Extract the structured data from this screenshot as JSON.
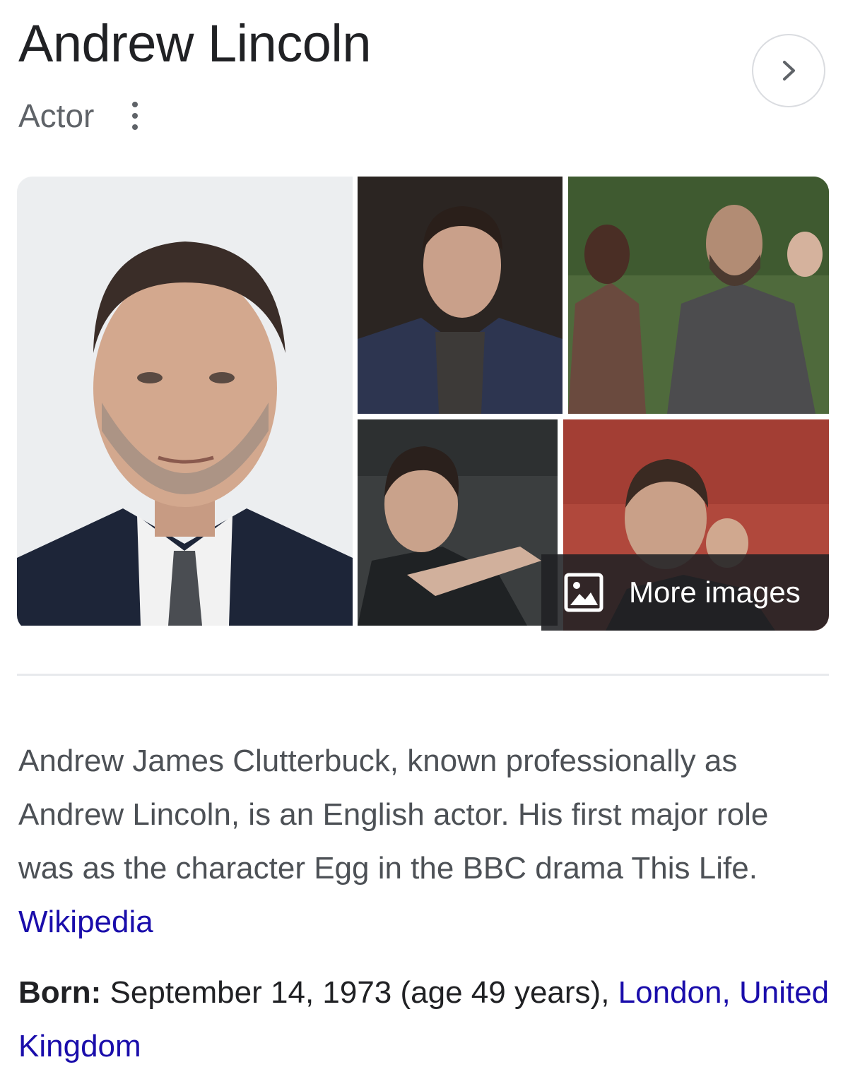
{
  "header": {
    "title": "Andrew Lincoln",
    "subtitle": "Actor"
  },
  "gallery": {
    "more_images_label": "More images"
  },
  "description": {
    "text": "Andrew James Clutterbuck, known professionally as Andrew Lincoln, is an English actor. His first major role was as the character Egg in the BBC drama This Life.",
    "source_link": "Wikipedia"
  },
  "facts": {
    "born_label": "Born:",
    "born_value": "September 14, 1973 (age 49 years),",
    "born_place_link": "London, United Kingdom"
  },
  "colors": {
    "link": "#1a0dab",
    "text_primary": "#202124",
    "text_secondary": "#4d5156",
    "divider": "#e8eaed"
  },
  "icons": [
    "more-vert-icon",
    "chevron-right-icon",
    "image-icon"
  ]
}
